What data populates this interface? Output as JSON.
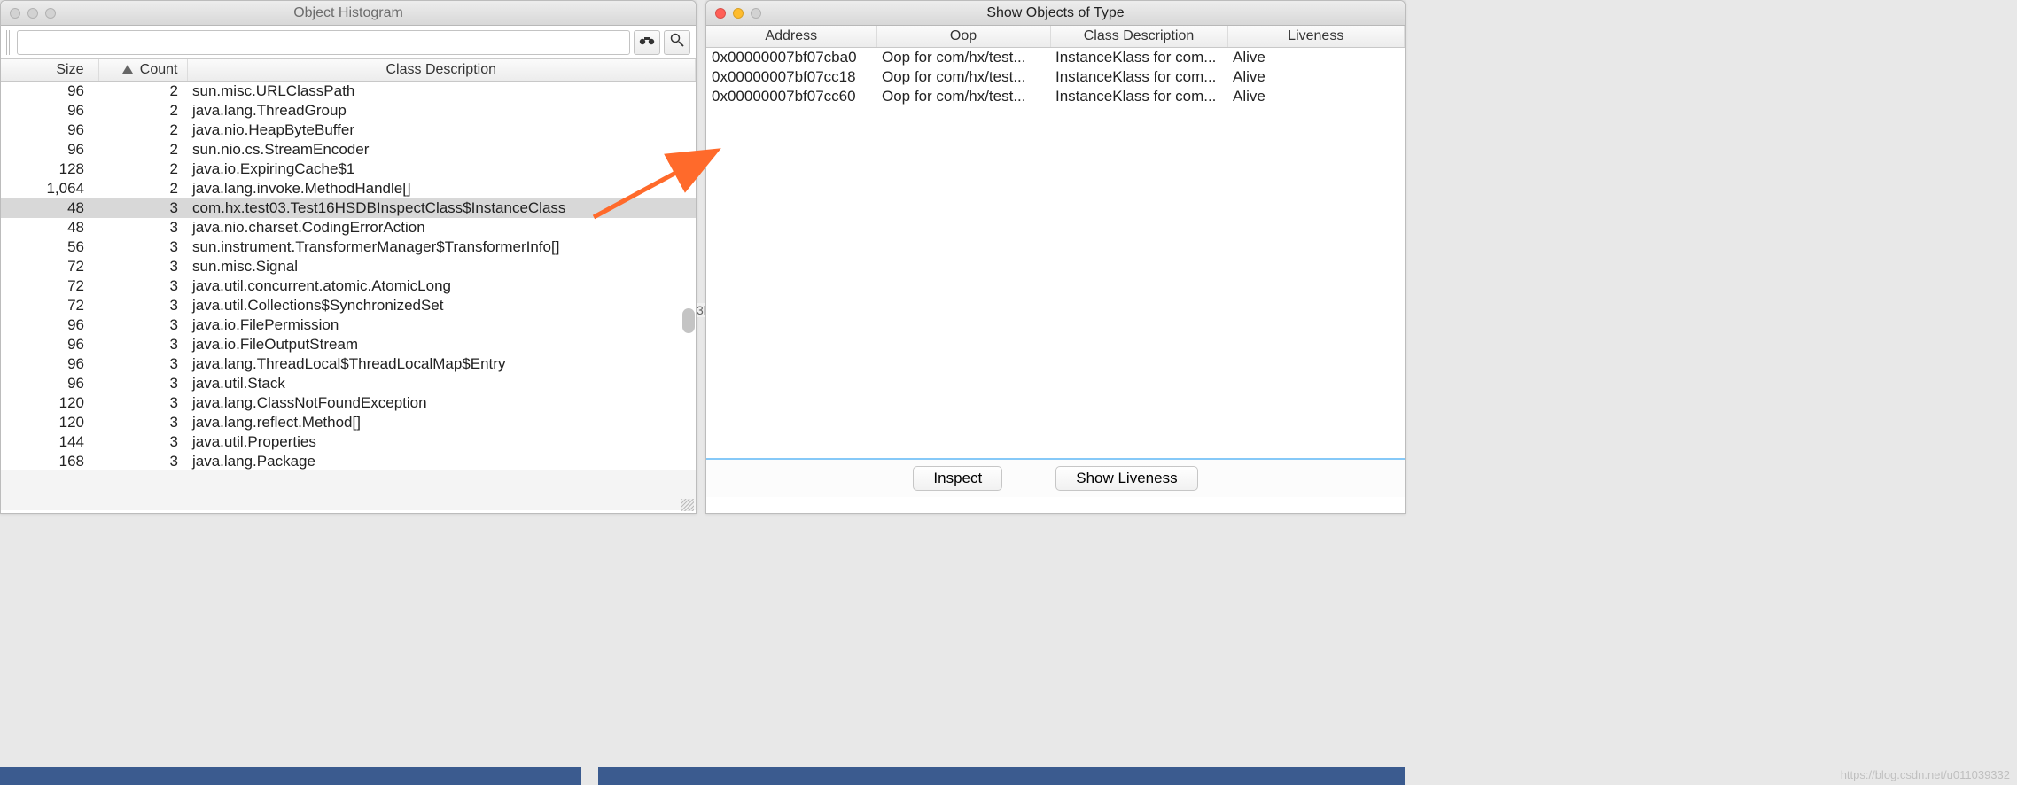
{
  "left_window": {
    "title": "Object Histogram",
    "search_value": "",
    "columns": {
      "size": "Size",
      "count": "Count",
      "desc": "Class Description"
    },
    "rows": [
      {
        "size": "96",
        "count": "2",
        "desc": "sun.misc.URLClassPath"
      },
      {
        "size": "96",
        "count": "2",
        "desc": "java.lang.ThreadGroup"
      },
      {
        "size": "96",
        "count": "2",
        "desc": "java.nio.HeapByteBuffer"
      },
      {
        "size": "96",
        "count": "2",
        "desc": "sun.nio.cs.StreamEncoder"
      },
      {
        "size": "128",
        "count": "2",
        "desc": "java.io.ExpiringCache$1"
      },
      {
        "size": "1,064",
        "count": "2",
        "desc": "java.lang.invoke.MethodHandle[]"
      },
      {
        "size": "48",
        "count": "3",
        "desc": "com.hx.test03.Test16HSDBInspectClass$InstanceClass",
        "selected": true
      },
      {
        "size": "48",
        "count": "3",
        "desc": "java.nio.charset.CodingErrorAction"
      },
      {
        "size": "56",
        "count": "3",
        "desc": "sun.instrument.TransformerManager$TransformerInfo[]"
      },
      {
        "size": "72",
        "count": "3",
        "desc": "sun.misc.Signal"
      },
      {
        "size": "72",
        "count": "3",
        "desc": "java.util.concurrent.atomic.AtomicLong"
      },
      {
        "size": "72",
        "count": "3",
        "desc": "java.util.Collections$SynchronizedSet"
      },
      {
        "size": "96",
        "count": "3",
        "desc": "java.io.FilePermission"
      },
      {
        "size": "96",
        "count": "3",
        "desc": "java.io.FileOutputStream"
      },
      {
        "size": "96",
        "count": "3",
        "desc": "java.lang.ThreadLocal$ThreadLocalMap$Entry"
      },
      {
        "size": "96",
        "count": "3",
        "desc": "java.util.Stack"
      },
      {
        "size": "120",
        "count": "3",
        "desc": "java.lang.ClassNotFoundException"
      },
      {
        "size": "120",
        "count": "3",
        "desc": "java.lang.reflect.Method[]"
      },
      {
        "size": "144",
        "count": "3",
        "desc": "java.util.Properties"
      },
      {
        "size": "168",
        "count": "3",
        "desc": "java.lang.Package"
      }
    ]
  },
  "right_window": {
    "title": "Show Objects of Type",
    "columns": {
      "addr": "Address",
      "oop": "Oop",
      "cls": "Class Description",
      "live": "Liveness"
    },
    "rows": [
      {
        "addr": "0x00000007bf07cba0",
        "oop": "Oop for com/hx/test...",
        "cls": "InstanceKlass for com...",
        "live": "Alive"
      },
      {
        "addr": "0x00000007bf07cc18",
        "oop": "Oop for com/hx/test...",
        "cls": "InstanceKlass for com...",
        "live": "Alive"
      },
      {
        "addr": "0x00000007bf07cc60",
        "oop": "Oop for com/hx/test...",
        "cls": "InstanceKlass for com...",
        "live": "Alive"
      }
    ],
    "buttons": {
      "inspect": "Inspect",
      "liveness": "Show Liveness"
    }
  },
  "colors": {
    "arrow": "#ff6a2b"
  },
  "watermark": "https://blog.csdn.net/u011039332"
}
